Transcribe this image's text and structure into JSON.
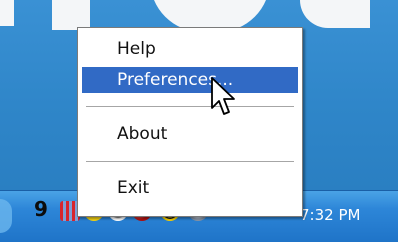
{
  "context_menu": {
    "items": [
      {
        "label": "Help",
        "highlighted": false
      },
      {
        "label": "Preferences...",
        "highlighted": true
      },
      {
        "label": "About",
        "highlighted": false
      },
      {
        "label": "Exit",
        "highlighted": false
      }
    ]
  },
  "taskbar": {
    "tray_count": "9",
    "clock": "7:32 PM",
    "tray_icons": [
      "app-icon",
      "alert-icon",
      "clock-icon",
      "network-icon",
      "status-icon",
      "volume-icon"
    ]
  },
  "colors": {
    "menu_highlight": "#316ac5",
    "desktop": "#2f86c9",
    "taskbar": "#2d86d8"
  }
}
